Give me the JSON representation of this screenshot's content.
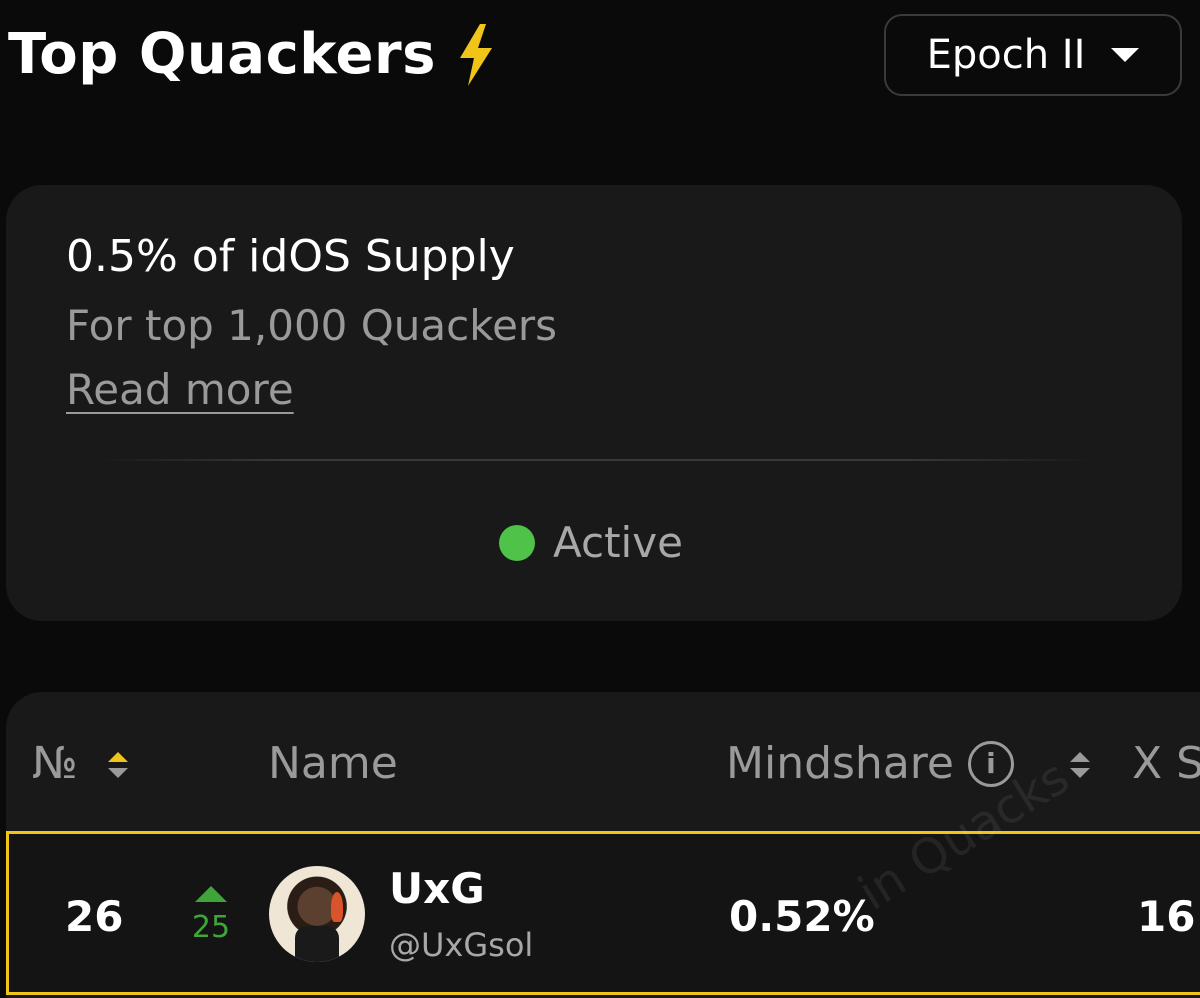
{
  "header": {
    "title": "Top Quackers",
    "title_icon": "lightning-bolt-icon",
    "epoch_selector": {
      "selected": "Epoch II"
    }
  },
  "info_card": {
    "headline": "0.5% of idOS Supply",
    "subtitle": "For top 1,000 Quackers",
    "read_more": "Read more",
    "status": "Active"
  },
  "table": {
    "columns": {
      "rank": "№",
      "name": "Name",
      "mindshare": "Mindshare",
      "x_score": "X S"
    },
    "rows": [
      {
        "rank": "26",
        "rank_change": "25",
        "username": "UxG",
        "handle": "@UxGsol",
        "mindshare": "0.52%",
        "x_score": "16"
      }
    ],
    "watermark": "in Quacks"
  },
  "colors": {
    "background": "#0a0a0a",
    "card": "#191919",
    "accent_yellow": "#f0c419",
    "status_green": "#4fc24a",
    "up_green": "#3fa53a",
    "muted_text": "#9a9a9a"
  }
}
